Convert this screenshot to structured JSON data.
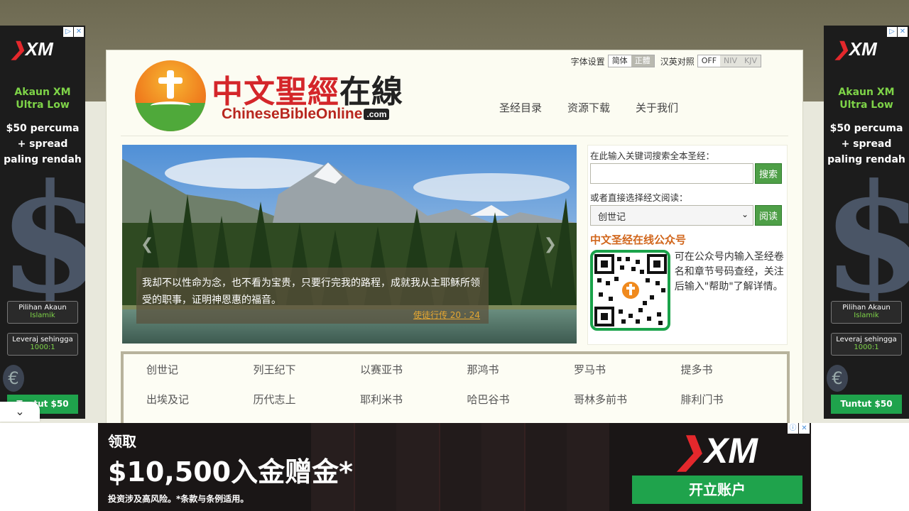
{
  "header": {
    "logo_cn_red": "中文聖經",
    "logo_cn_dark": "在線",
    "logo_en": "ChineseBibleOnline",
    "logo_en_domain": ".com",
    "settings": {
      "font_label": "字体设置",
      "simplified": "简体",
      "traditional": "正體",
      "parallel_label": "汉英对照",
      "off": "OFF",
      "niv": "NIV",
      "kjv": "KJV"
    },
    "nav": [
      "圣经目录",
      "资源下载",
      "关于我们"
    ]
  },
  "carousel": {
    "verse": "我却不以性命为念，也不看为宝贵，只要行完我的路程，成就我从主耶稣所领受的职事，证明神恩惠的福音。",
    "reference": "使徒行传 20 : 24",
    "prev_icon": "chevron-left-icon",
    "next_icon": "chevron-right-icon"
  },
  "search": {
    "label": "在此输入关键词搜索全本圣经：",
    "placeholder": "",
    "button": "搜索"
  },
  "read": {
    "label": "或者直接选择经文阅读：",
    "selected": "创世记",
    "button": "阅读"
  },
  "wechat": {
    "title": "中文圣经在线公众号",
    "description": "可在公众号内输入圣经卷名和章节号码查经，关注后输入\"帮助\"了解详情。"
  },
  "books": [
    "创世记",
    "列王纪下",
    "以赛亚书",
    "那鸿书",
    "罗马书",
    "提多书",
    "出埃及记",
    "历代志上",
    "耶利米书",
    "哈巴谷书",
    "哥林多前书",
    "腓利门书"
  ],
  "side_ad": {
    "brand": "XM",
    "line1": "Akaun XM",
    "line2": "Ultra Low",
    "line3": "$50 percuma",
    "line4": "+ spread",
    "line5": "paling rendah",
    "box1_title": "Pilihan Akaun",
    "box1_sub": "Islamik",
    "box2_title": "Leveraj sehingga",
    "box2_sub": "1000:1",
    "cta": "Tuntut $50"
  },
  "bottom_ad": {
    "line1": "领取",
    "line2": "$10,500入金赠金*",
    "line3": "投资涉及高风险。*条款与条例适用。",
    "brand": "XM",
    "cta": "开立账户"
  },
  "colors": {
    "accent_green": "#4e9f47",
    "wechat_orange": "#d1661c",
    "logo_red": "#d4262a"
  }
}
